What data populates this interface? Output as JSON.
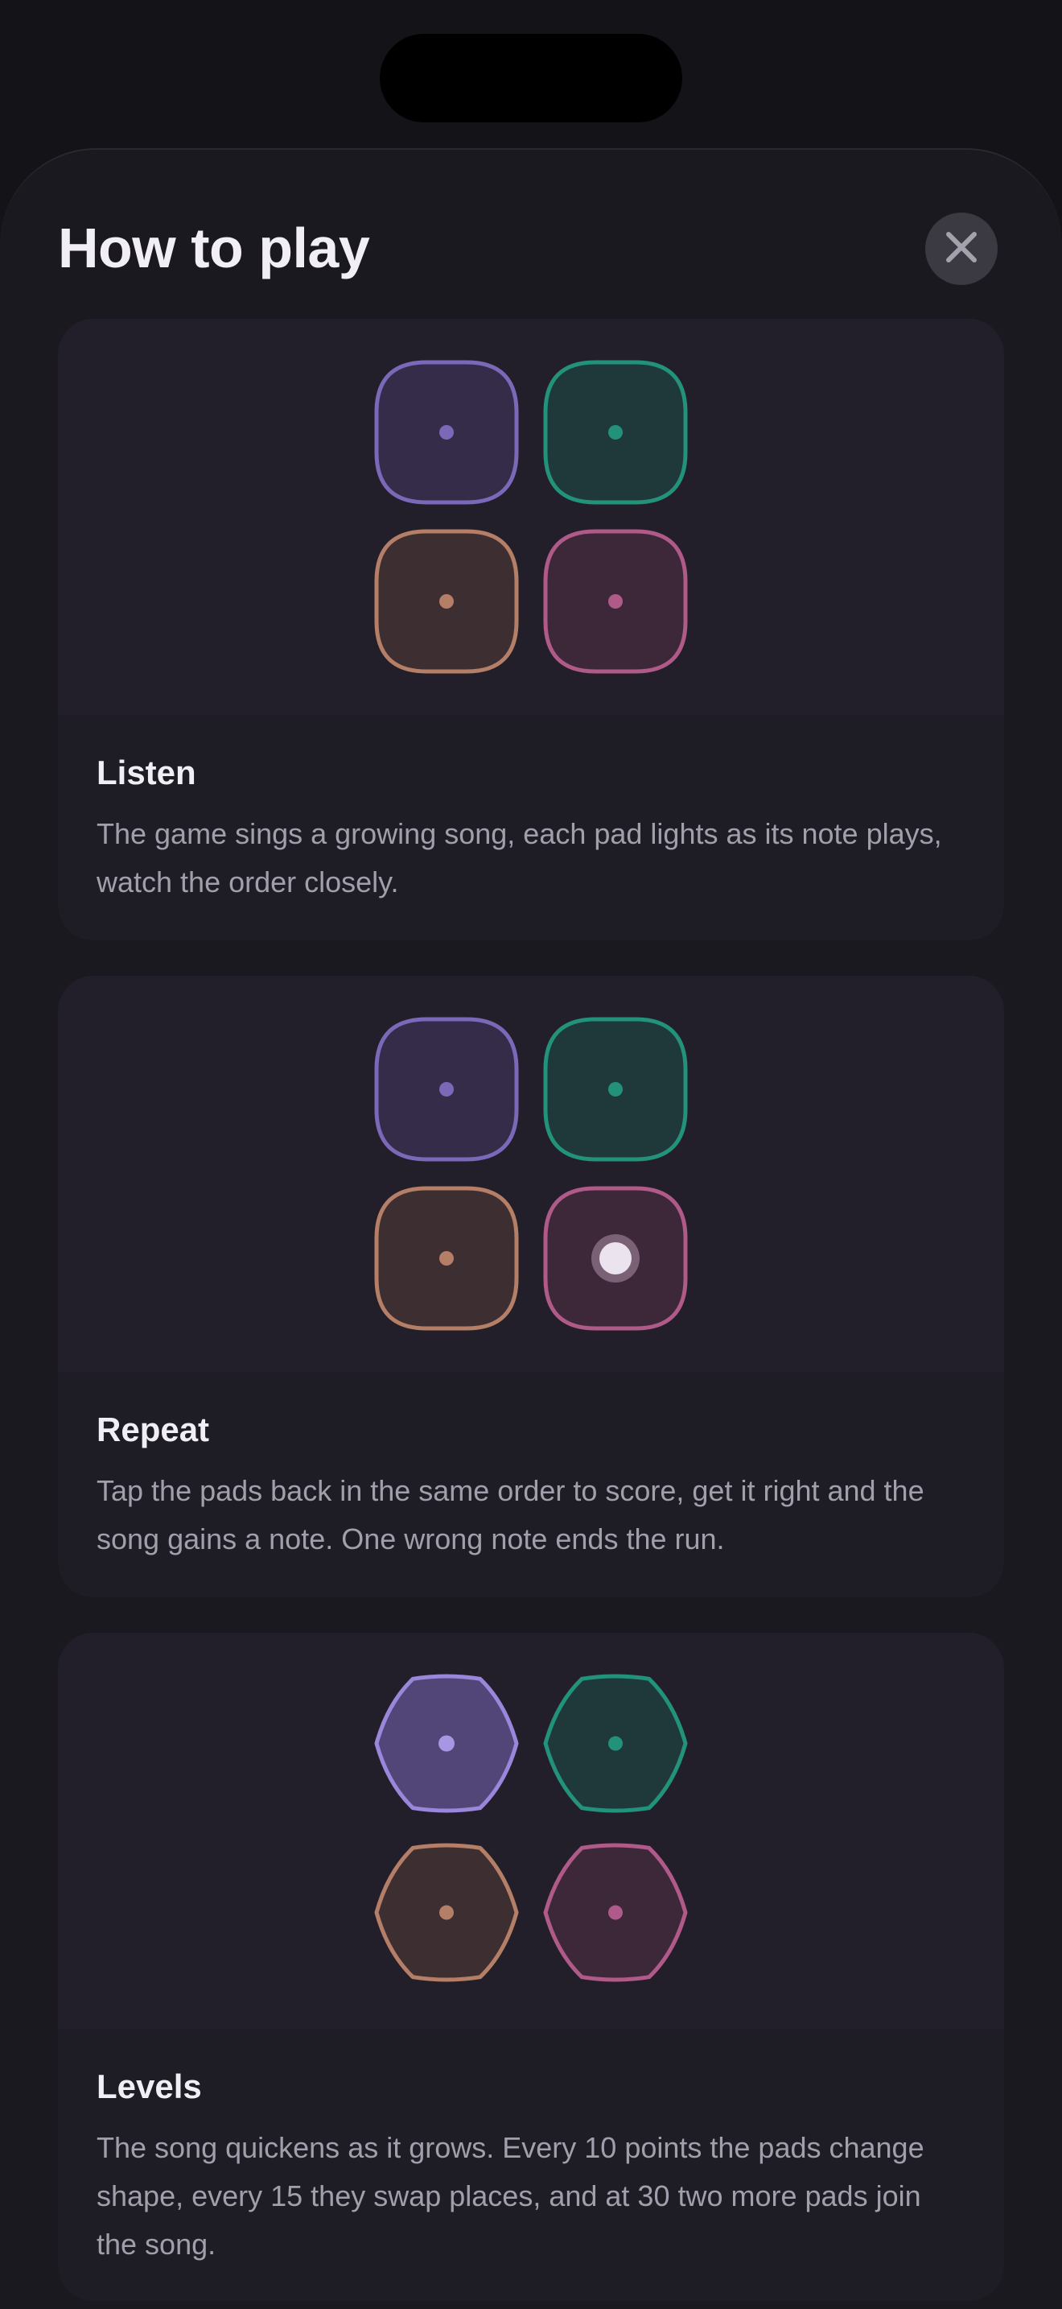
{
  "sheet": {
    "title": "How to play",
    "close_icon": "close-icon"
  },
  "colors": {
    "purple": "#7c68b8",
    "green": "#22927a",
    "orange": "#b57e66",
    "pink": "#b05a8a"
  },
  "cards": [
    {
      "title": "Listen",
      "body": "The game sings a growing song, each pad lights as its note plays, watch the order closely.",
      "pad_shape": "rounded-square",
      "lit_pad": null,
      "pressed_pad": null
    },
    {
      "title": "Repeat",
      "body": "Tap the pads back in the same order to score, get it right and the song gains a note. One wrong note ends the run.",
      "pad_shape": "rounded-square",
      "lit_pad": null,
      "pressed_pad": "pink"
    },
    {
      "title": "Levels",
      "body": "The song quickens as it grows. Every 10 points the pads change shape, every 15 they swap places, and at 30 two more pads join the song.",
      "pad_shape": "hexagon",
      "lit_pad": "purple",
      "pressed_pad": null
    }
  ]
}
